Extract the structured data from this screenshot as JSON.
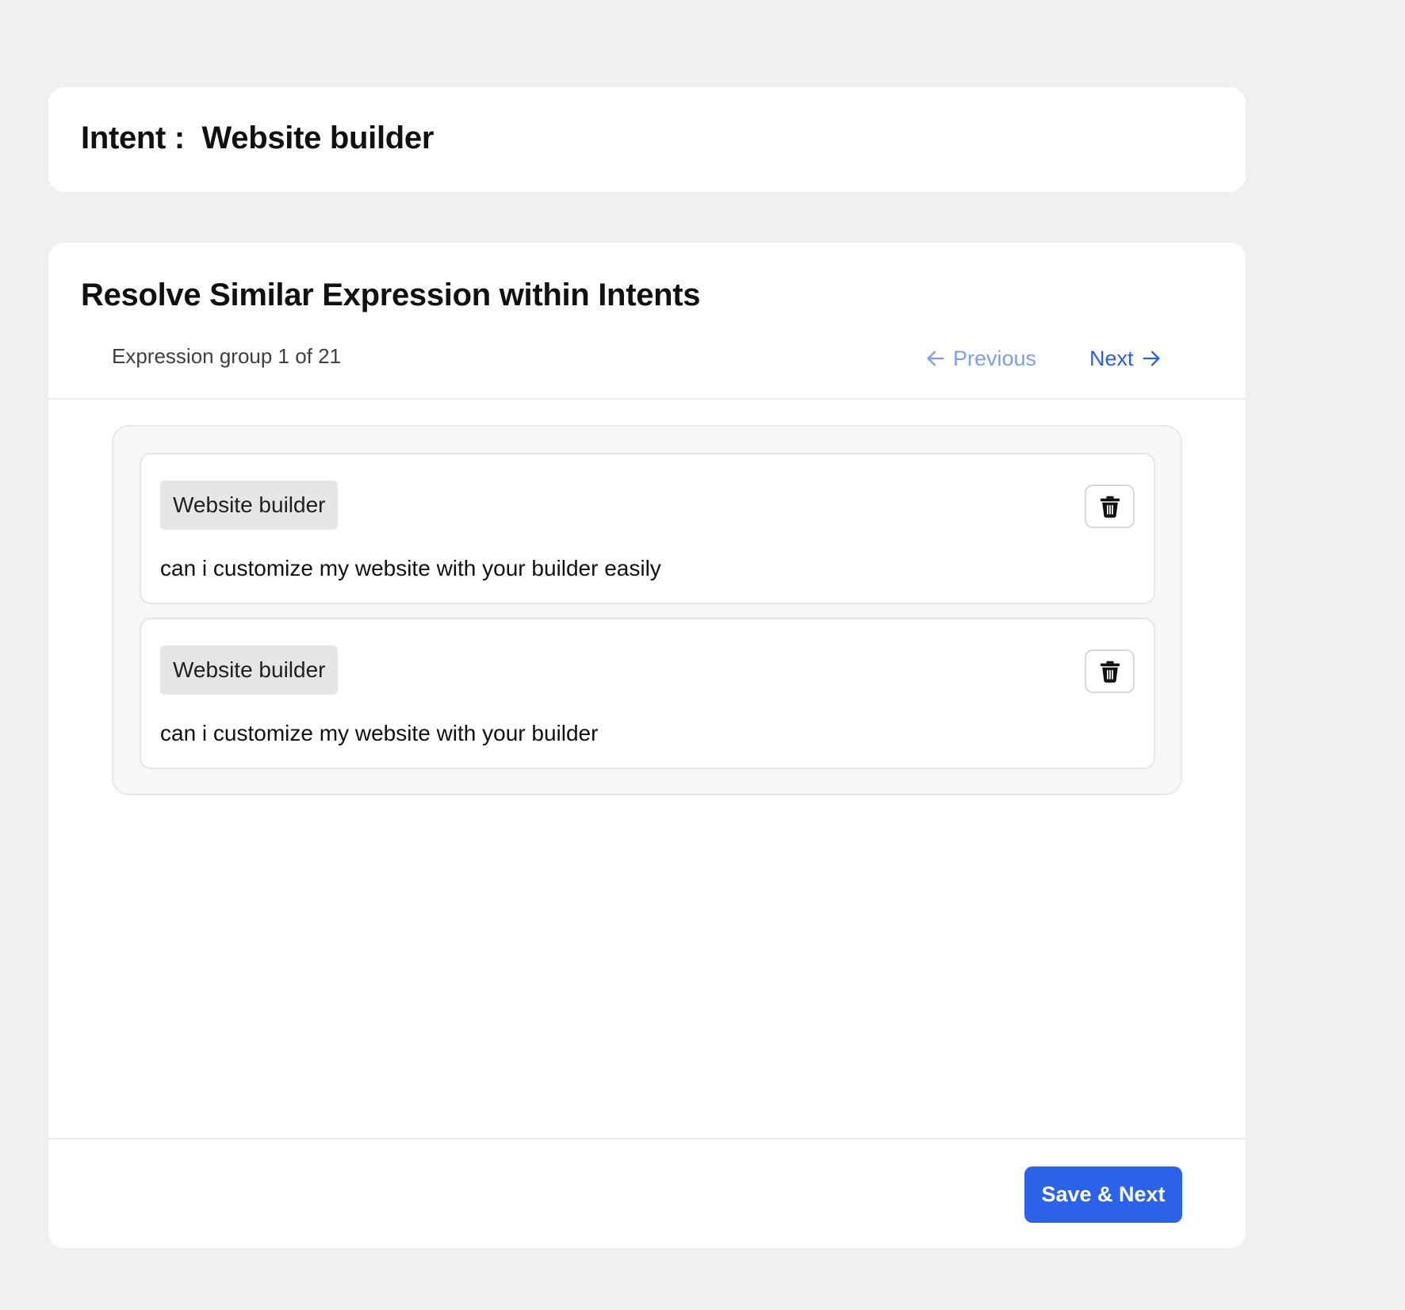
{
  "intent_card": {
    "label": "Intent :",
    "value": "Website builder"
  },
  "resolve_card": {
    "title": "Resolve Similar Expression within Intents",
    "group_counter": "Expression group 1 of 21",
    "previous_label": "Previous",
    "next_label": "Next",
    "save_label": "Save & Next"
  },
  "expressions": [
    {
      "intent": "Website builder",
      "text": "can i customize my website with your builder easily"
    },
    {
      "intent": "Website builder",
      "text": "can i customize my website with your builder"
    }
  ],
  "icons": {
    "previous": "arrow-left-icon",
    "next": "arrow-right-icon",
    "delete": "trash-icon"
  },
  "colors": {
    "accent": "#2b62ea",
    "link": "#2c5ee8",
    "link_disabled": "#7f9cf0",
    "background": "#eff0f2"
  }
}
